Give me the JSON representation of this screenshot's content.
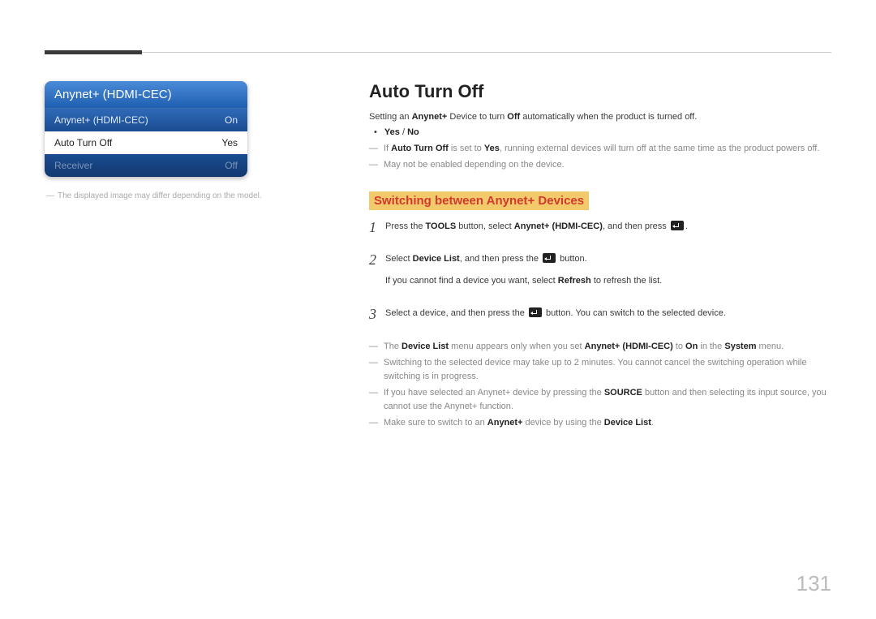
{
  "ui_panel": {
    "title": "Anynet+ (HDMI-CEC)",
    "rows": [
      {
        "label": "Anynet+ (HDMI-CEC)",
        "value": "On"
      },
      {
        "label": "Auto Turn Off",
        "value": "Yes"
      },
      {
        "label": "Receiver",
        "value": "Off"
      }
    ],
    "caption": "The displayed image may differ depending on the model."
  },
  "section_title": "Auto Turn Off",
  "intro": {
    "pre": "Setting an ",
    "red1": "Anynet+",
    "mid1": " Device to turn ",
    "bold1": "Off",
    "post": " automatically when the product is turned off."
  },
  "options": {
    "yes": "Yes",
    "sep": " / ",
    "no": "No"
  },
  "notes_top": [
    {
      "parts": [
        {
          "t": "If ",
          "cls": ""
        },
        {
          "t": "Auto Turn Off",
          "cls": "red bold"
        },
        {
          "t": " is set to ",
          "cls": ""
        },
        {
          "t": "Yes",
          "cls": "red bold"
        },
        {
          "t": ", running external devices will turn off at the same time as the product powers off.",
          "cls": ""
        }
      ]
    },
    {
      "parts": [
        {
          "t": "May not be enabled depending on the device.",
          "cls": ""
        }
      ]
    }
  ],
  "subheading": "Switching between Anynet+ Devices",
  "steps": [
    {
      "num": "1",
      "lines": [
        [
          {
            "t": "Press the ",
            "cls": ""
          },
          {
            "t": "TOOLS",
            "cls": "bold"
          },
          {
            "t": " button, select ",
            "cls": ""
          },
          {
            "t": "Anynet+ (HDMI-CEC)",
            "cls": "red bold"
          },
          {
            "t": ", and then press ",
            "cls": ""
          },
          {
            "t": "[ICON]",
            "cls": "icon"
          },
          {
            "t": ".",
            "cls": ""
          }
        ]
      ]
    },
    {
      "num": "2",
      "lines": [
        [
          {
            "t": "Select ",
            "cls": ""
          },
          {
            "t": "Device List",
            "cls": "red bold"
          },
          {
            "t": ", and then press the ",
            "cls": ""
          },
          {
            "t": "[ICON]",
            "cls": "icon"
          },
          {
            "t": " button.",
            "cls": ""
          }
        ],
        [
          {
            "t": "If you cannot find a device you want, select ",
            "cls": ""
          },
          {
            "t": "Refresh",
            "cls": "red bold"
          },
          {
            "t": " to refresh the list.",
            "cls": ""
          }
        ]
      ]
    },
    {
      "num": "3",
      "lines": [
        [
          {
            "t": "Select a device, and then press the ",
            "cls": ""
          },
          {
            "t": "[ICON]",
            "cls": "icon"
          },
          {
            "t": " button. You can switch to the selected device.",
            "cls": ""
          }
        ]
      ]
    }
  ],
  "notes_bottom": [
    {
      "parts": [
        {
          "t": "The ",
          "cls": ""
        },
        {
          "t": "Device List",
          "cls": "red bold"
        },
        {
          "t": " menu appears only when you set ",
          "cls": ""
        },
        {
          "t": "Anynet+ (HDMI-CEC)",
          "cls": "red bold"
        },
        {
          "t": " to ",
          "cls": ""
        },
        {
          "t": "On",
          "cls": "red bold"
        },
        {
          "t": " in the ",
          "cls": ""
        },
        {
          "t": "System",
          "cls": "red bold"
        },
        {
          "t": " menu.",
          "cls": ""
        }
      ]
    },
    {
      "parts": [
        {
          "t": "Switching to the selected device may take up to 2 minutes. You cannot cancel the switching operation while switching is in progress.",
          "cls": ""
        }
      ]
    },
    {
      "parts": [
        {
          "t": "If you have selected an Anynet+ device by pressing the ",
          "cls": ""
        },
        {
          "t": "SOURCE",
          "cls": "bold"
        },
        {
          "t": " button and then selecting its input source, you cannot use the Anynet+ function.",
          "cls": ""
        }
      ]
    },
    {
      "parts": [
        {
          "t": "Make sure to switch to an ",
          "cls": ""
        },
        {
          "t": "Anynet+",
          "cls": "red bold"
        },
        {
          "t": " device by using the ",
          "cls": ""
        },
        {
          "t": "Device List",
          "cls": "red bold"
        },
        {
          "t": ".",
          "cls": ""
        }
      ]
    }
  ],
  "page_number": "131"
}
